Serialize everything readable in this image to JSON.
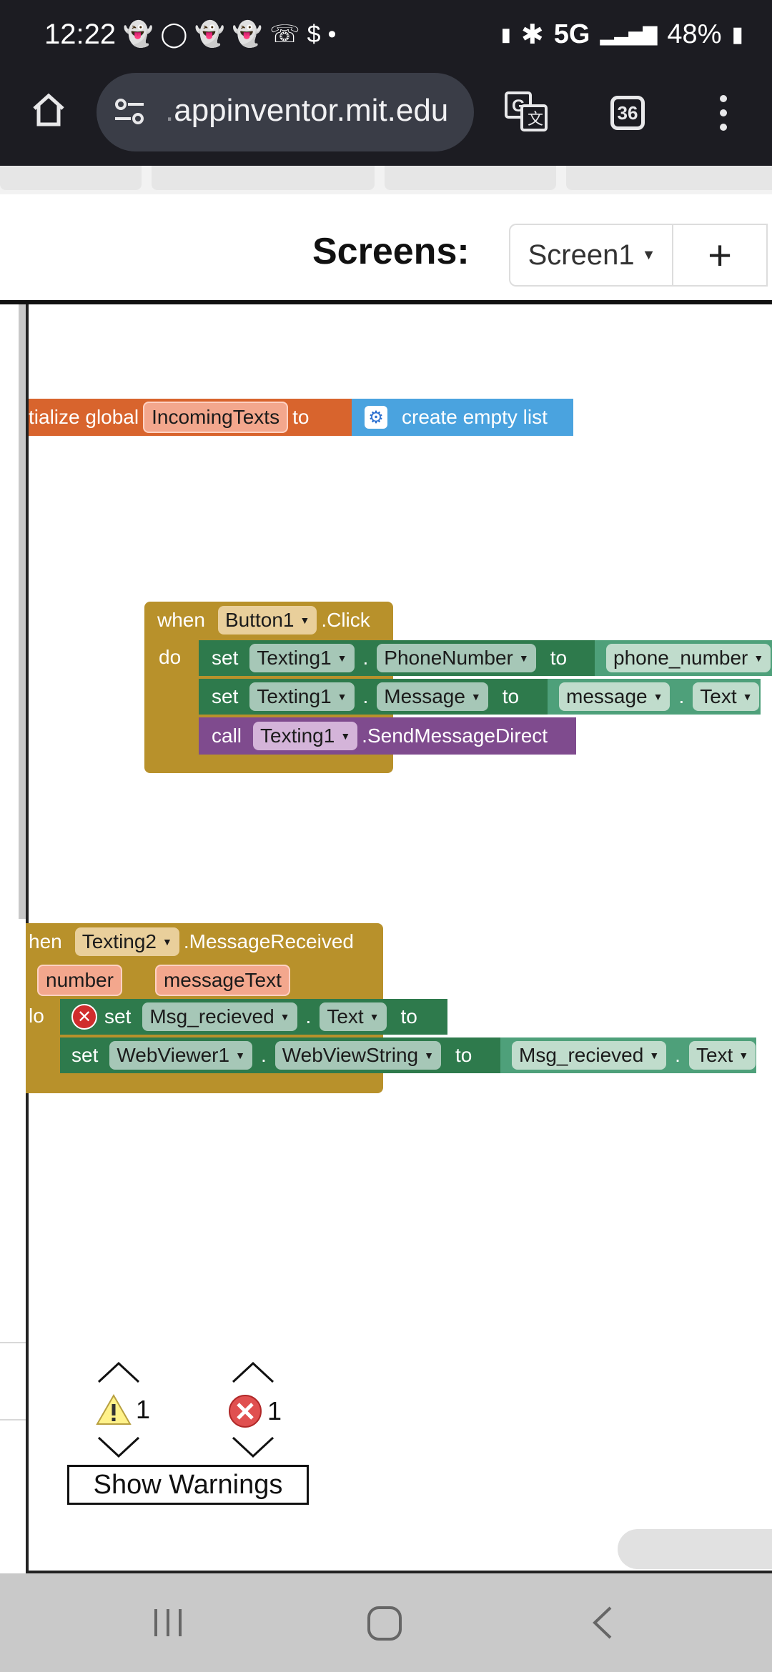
{
  "status": {
    "time": "12:22",
    "notif_icons": [
      "snapchat-icon",
      "messenger-icon",
      "snapchat-icon",
      "snapchat-icon",
      "snapchat-icon",
      "whatsapp-icon",
      "dollar-icon",
      "dot-icon"
    ],
    "network": "5G",
    "battery": "48%"
  },
  "browser": {
    "url_prefix": ".",
    "url": "appinventor.mit.edu",
    "tab_count": "36"
  },
  "app": {
    "screens_label": "Screens:",
    "current_screen": "Screen1",
    "add_screen_label": "+"
  },
  "blocks": {
    "global": {
      "prefix": "tialize global",
      "var_name": "IncomingTexts",
      "to": "to",
      "value": "create empty list"
    },
    "button_click": {
      "when": "when",
      "component": "Button1",
      "event": ".Click",
      "do": "do",
      "stmt1": {
        "set": "set",
        "comp": "Texting1",
        "prop": "PhoneNumber",
        "to": "to",
        "value": "phone_number"
      },
      "stmt2": {
        "set": "set",
        "comp": "Texting1",
        "prop": "Message",
        "to": "to",
        "value_comp": "message",
        "value_prop": "Text"
      },
      "stmt3": {
        "call": "call",
        "comp": "Texting1",
        "method": ".SendMessageDirect"
      }
    },
    "message_received": {
      "when": "hen",
      "component": "Texting2",
      "event": ".MessageReceived",
      "param1": "number",
      "param2": "messageText",
      "do": "lo",
      "stmt1": {
        "set": "set",
        "comp": "Msg_recieved",
        "prop": "Text",
        "to": "to"
      },
      "stmt2": {
        "set": "set",
        "comp": "WebViewer1",
        "prop": "WebViewString",
        "to": "to",
        "value_comp": "Msg_recieved",
        "value_prop": "Text"
      }
    },
    "dot": "."
  },
  "warnings": {
    "warning_count": "1",
    "error_count": "1",
    "show_warnings_label": "Show Warnings"
  },
  "colors": {
    "variable_orange": "#d8642d",
    "list_blue": "#4aa3df",
    "event_gold": "#b8912b",
    "setter_green": "#2e7a4c",
    "getter_green": "#4ea07a",
    "call_purple": "#7f4b8e"
  }
}
